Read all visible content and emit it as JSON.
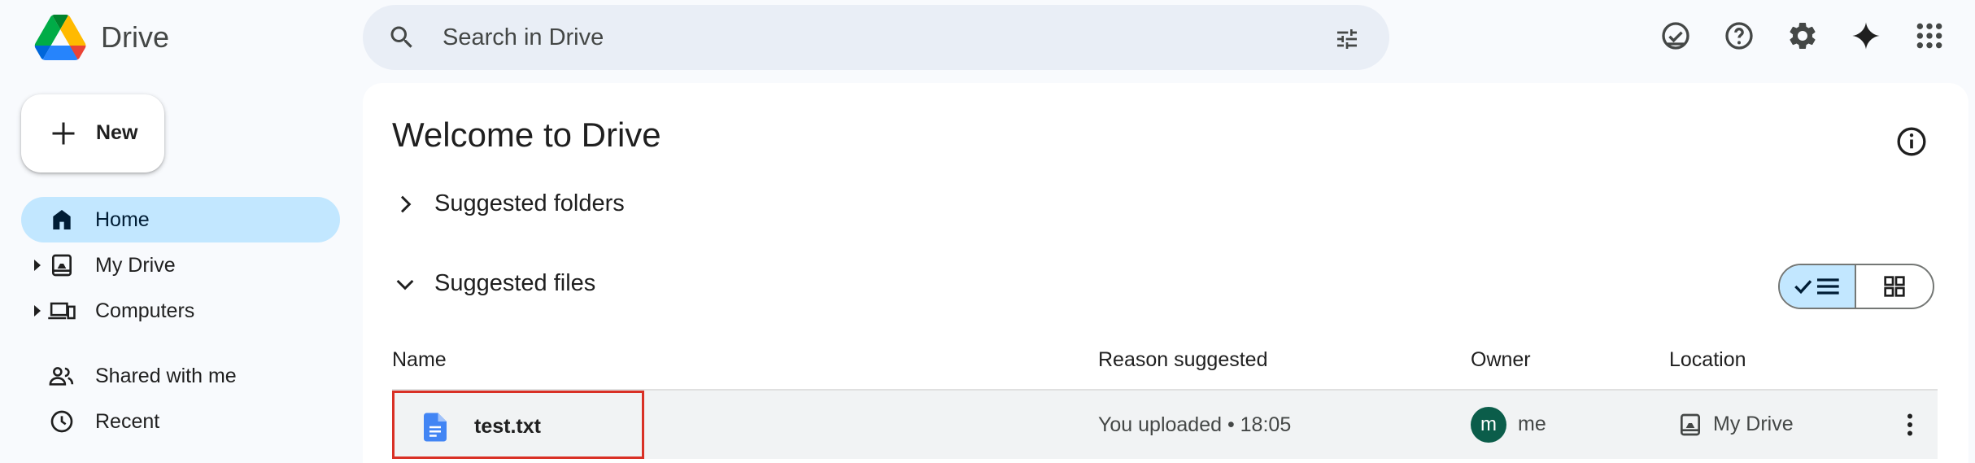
{
  "app": {
    "name": "Drive"
  },
  "search": {
    "placeholder": "Search in Drive",
    "value": ""
  },
  "toolbar_icons": [
    "ready-for-offline-icon",
    "help-icon",
    "settings-icon",
    "gemini-sparkle-icon",
    "apps-grid-icon"
  ],
  "new_button": {
    "label": "New"
  },
  "sidebar": {
    "items": [
      {
        "label": "Home",
        "icon": "home-icon",
        "active": true,
        "expandable": false
      },
      {
        "label": "My Drive",
        "icon": "my-drive-icon",
        "active": false,
        "expandable": true
      },
      {
        "label": "Computers",
        "icon": "computers-icon",
        "active": false,
        "expandable": true
      },
      {
        "label": "Shared with me",
        "icon": "shared-icon",
        "active": false,
        "expandable": false
      },
      {
        "label": "Recent",
        "icon": "clock-icon",
        "active": false,
        "expandable": false
      }
    ]
  },
  "main": {
    "title": "Welcome to Drive",
    "suggested_folders": {
      "label": "Suggested folders",
      "expanded": false
    },
    "suggested_files": {
      "label": "Suggested files",
      "expanded": true
    },
    "view_mode": "list",
    "columns": {
      "name": "Name",
      "reason": "Reason suggested",
      "owner": "Owner",
      "location": "Location"
    },
    "files": [
      {
        "name": "test.txt",
        "reason": "You uploaded • 18:05",
        "owner_initial": "m",
        "owner": "me",
        "location": "My Drive",
        "selected": true
      }
    ]
  },
  "colors": {
    "accent_bg": "#c2e7ff",
    "search_bg": "#e9eef6",
    "highlight_border": "#d93025",
    "avatar": "#0b5d4a",
    "doc_blue": "#4285f4"
  }
}
